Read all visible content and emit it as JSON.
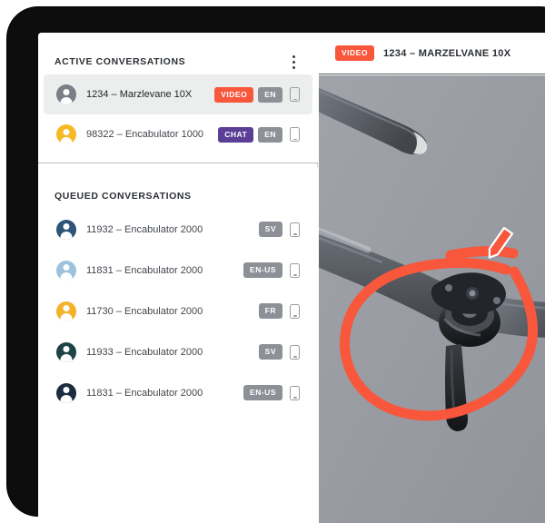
{
  "active_panel": {
    "title": "ACTIVE CONVERSATIONS",
    "menu_icon": "kebab-menu-icon",
    "rows": [
      {
        "label": "1234 – Marzlevane 10X",
        "type_badge": "VIDEO",
        "lang_badge": "EN",
        "avatar_color": "#7b7f85",
        "type_color": "#f8573c",
        "selected": true,
        "device_icon": "mobile-phone-icon"
      },
      {
        "label": "98322 – Encabulator 1000",
        "type_badge": "CHAT",
        "lang_badge": "EN",
        "avatar_color": "#f6b925",
        "type_color": "#5b3e96",
        "selected": false,
        "device_icon": "mobile-phone-icon"
      }
    ]
  },
  "queued_panel": {
    "title": "QUEUED CONVERSATIONS",
    "rows": [
      {
        "label": "11932 – Encabulator 2000",
        "lang_badge": "SV",
        "avatar_color": "#2e5478",
        "device_icon": "mobile-phone-icon"
      },
      {
        "label": "11831 – Encabulator 2000",
        "lang_badge": "EN-US",
        "avatar_color": "#9cc2dd",
        "device_icon": "mobile-phone-icon"
      },
      {
        "label": "11730 – Encabulator 2000",
        "lang_badge": "FR",
        "avatar_color": "#f4b12a",
        "device_icon": "mobile-phone-icon"
      },
      {
        "label": "11933 – Encabulator 2000",
        "lang_badge": "SV",
        "avatar_color": "#1d4346",
        "device_icon": "mobile-phone-icon"
      },
      {
        "label": "11831 – Encabulator 2000",
        "lang_badge": "EN-US",
        "avatar_color": "#1d2d40",
        "device_icon": "mobile-phone-icon"
      }
    ]
  },
  "video_panel": {
    "type_badge": "VIDEO",
    "title": "1234 – MARZELVANE 10X",
    "annotation_color": "#f8573c",
    "background_color": "#9a9da3",
    "annotation_tool": "pencil-cursor-icon"
  },
  "colors": {
    "accent_orange": "#f8573c",
    "accent_purple": "#5b3e96",
    "badge_gray": "#8d9096",
    "bezel": "#0d0d0d"
  }
}
